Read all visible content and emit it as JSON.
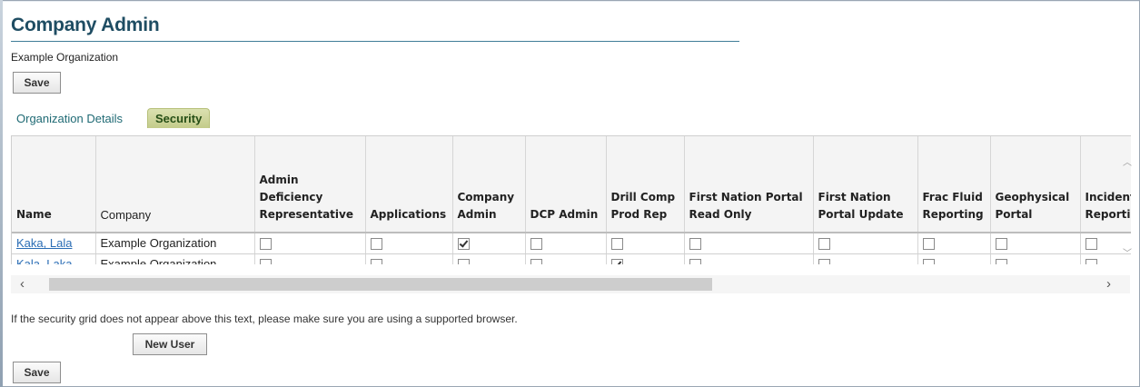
{
  "page": {
    "title": "Company Admin",
    "organization_name": "Example Organization",
    "save_label": "Save",
    "new_user_label": "New User",
    "note": "If the security grid does not appear above this text, please make sure you are using a supported browser."
  },
  "tabs": [
    {
      "label": "Organization Details",
      "active": false
    },
    {
      "label": "Security",
      "active": true
    }
  ],
  "grid": {
    "columns": [
      {
        "key": "name",
        "label": "Name"
      },
      {
        "key": "company",
        "label": "Company"
      },
      {
        "key": "admin_def",
        "label": "Admin Deficiency Representative"
      },
      {
        "key": "applications",
        "label": "Applications"
      },
      {
        "key": "company_admin",
        "label": "Company Admin"
      },
      {
        "key": "dcp_admin",
        "label": "DCP Admin"
      },
      {
        "key": "drill_comp",
        "label": "Drill Comp Prod Rep"
      },
      {
        "key": "fn_read",
        "label": "First Nation Portal Read Only"
      },
      {
        "key": "fn_update",
        "label": "First Nation Portal Update"
      },
      {
        "key": "frac",
        "label": "Frac Fluid Reporting"
      },
      {
        "key": "geo",
        "label": "Geophysical Portal"
      },
      {
        "key": "incident",
        "label": "Incident Reporting"
      }
    ],
    "rows": [
      {
        "name": "Kaka, Lala",
        "company": "Example Organization",
        "checks": [
          false,
          false,
          true,
          false,
          false,
          false,
          false,
          false,
          false,
          false
        ]
      },
      {
        "name": "Kala, Laka",
        "company": "Example Organization",
        "checks": [
          false,
          false,
          false,
          false,
          true,
          false,
          false,
          false,
          false,
          false
        ]
      }
    ]
  },
  "icons": {
    "scroll_left": "chevron-left-icon",
    "scroll_right": "chevron-right-icon",
    "scroll_up": "chevron-up-icon",
    "scroll_down": "chevron-down-icon"
  }
}
